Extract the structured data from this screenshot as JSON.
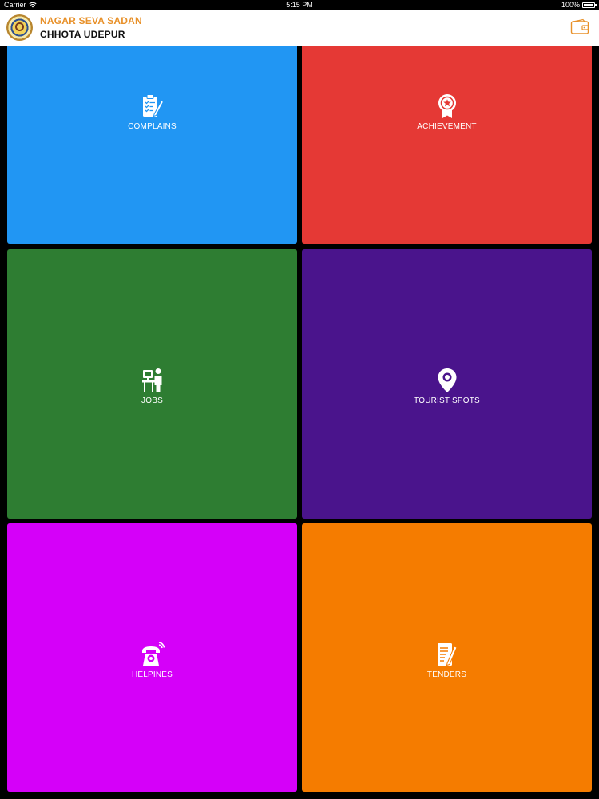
{
  "status_bar": {
    "carrier": "Carrier",
    "time": "5:15 PM",
    "battery": "100%"
  },
  "header": {
    "title_line1": "NAGAR SEVA SADAN",
    "title_line2": "CHHOTA UDEPUR",
    "title_color": "#e8912a"
  },
  "tiles": [
    {
      "label": "COMPLAINS",
      "icon": "clipboard-pen-icon",
      "color": "#2196f3"
    },
    {
      "label": "ACHIEVEMENT",
      "icon": "award-ribbon-icon",
      "color": "#e53935"
    },
    {
      "label": "JOBS",
      "icon": "person-at-desk-icon",
      "color": "#2e7d32"
    },
    {
      "label": "TOURIST SPOTS",
      "icon": "map-pin-icon",
      "color": "#4a148c"
    },
    {
      "label": "HELPINES",
      "icon": "telephone-ringing-icon",
      "color": "#d500f9"
    },
    {
      "label": "TENDERS",
      "icon": "document-pen-icon",
      "color": "#f57c00"
    }
  ]
}
